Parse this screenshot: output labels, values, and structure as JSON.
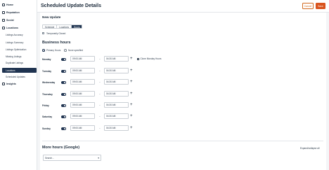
{
  "sidebar": {
    "home": "Home",
    "reputation": "Reputation",
    "social": "Social",
    "locations": "Locations",
    "sub_items": [
      "Listings Accuracy",
      "Listings Summary",
      "Listings Optimization",
      "Missing Listings",
      "Duplicate Listings"
    ],
    "active_item": "Locations",
    "after_active": "Scheduled Updates",
    "insights": "Insights"
  },
  "header": {
    "title": "Scheduled Update Details",
    "cancel_label": "Cancel",
    "save_label": "Save"
  },
  "form": {
    "section_title": "New Update",
    "tabs": [
      "Schedule",
      "Locations",
      "Hours"
    ],
    "active_tab": "Hours",
    "temporarily_closed_label": "Temporarily Closed",
    "business_hours_title": "Business hours",
    "radio_primary": "Primary Hours",
    "radio_none": "None specified",
    "clone_label": "Clone Monday Hours",
    "days": [
      {
        "name": "Monday",
        "open": "09:00 AM",
        "close": "04:30 AM"
      },
      {
        "name": "Tuesday",
        "open": "09:00 AM",
        "close": "04:30 AM"
      },
      {
        "name": "Wednesday",
        "open": "09:00 AM",
        "close": "04:30 AM"
      },
      {
        "name": "Thursday",
        "open": "09:00 AM",
        "close": "04:30 AM"
      },
      {
        "name": "Friday",
        "open": "09:00 AM",
        "close": "04:30 AM"
      },
      {
        "name": "Saturday",
        "open": "09:00 AM",
        "close": "04:30 AM"
      },
      {
        "name": "Sunday",
        "open": "09:00 AM",
        "close": "04:30 AM"
      }
    ],
    "more_hours_title": "More hours (Google)",
    "expand_label": "Expand/collapse all",
    "search_placeholder": "Search..."
  },
  "colors": {
    "navy": "#1f3350",
    "accent": "#d9541e"
  }
}
